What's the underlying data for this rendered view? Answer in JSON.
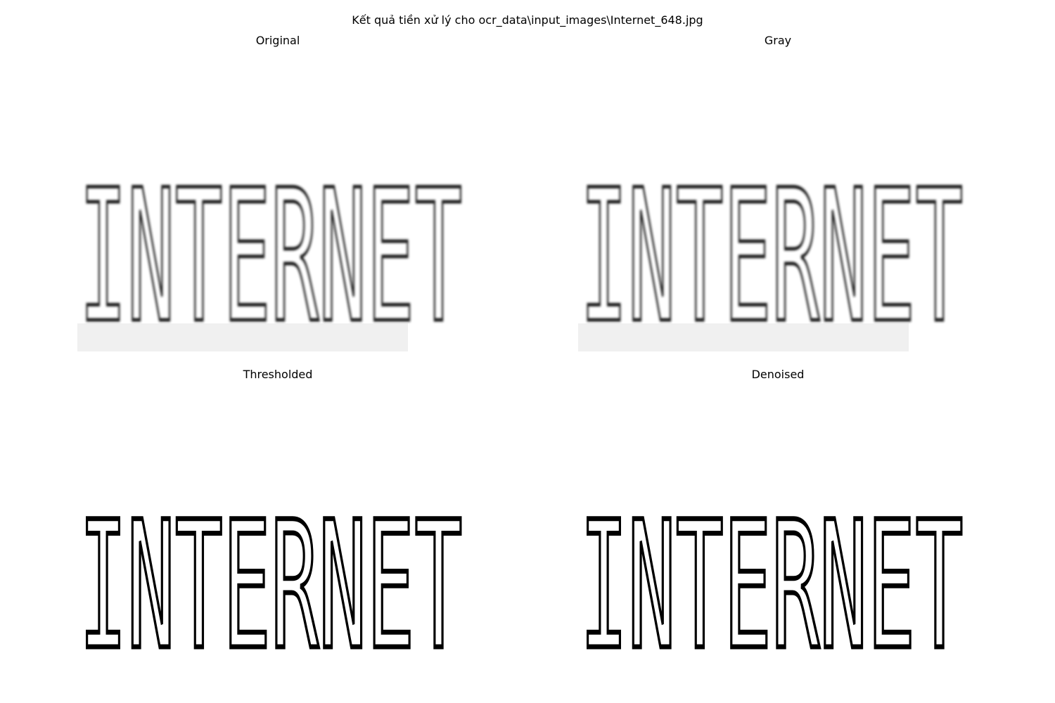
{
  "figure": {
    "suptitle": "Kết quả tiền xử lý cho ocr_data\\input_images\\Internet_648.jpg"
  },
  "panels": [
    {
      "title": "Original",
      "word": "INTERNET",
      "style": "soft"
    },
    {
      "title": "Gray",
      "word": "INTERNET",
      "style": "soft"
    },
    {
      "title": "Thresholded",
      "word": "INTERNET",
      "style": "binary"
    },
    {
      "title": "Denoised",
      "word": "INTERNET",
      "style": "binary"
    }
  ],
  "colors": {
    "background": "#ffffff",
    "ink": "#000000",
    "soft_ink": "#1a1a1a"
  }
}
